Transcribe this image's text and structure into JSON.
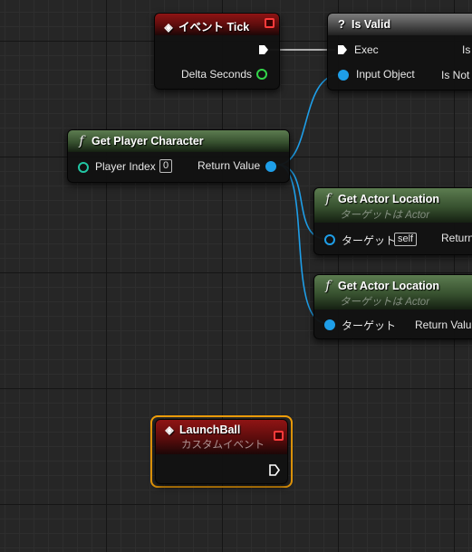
{
  "colors": {
    "event_header": "#8f1414",
    "pure_header": "#5c7c50",
    "macro_header": "#7c7c7c",
    "object_pin": "#1e9ee8",
    "float_pin": "#33d64a",
    "int_pin": "#22c6a4",
    "selection": "#f5a20a"
  },
  "nodes": {
    "event_tick": {
      "title": "イベント Tick",
      "icon": "event-diamond-icon",
      "out_pin": "Delta Seconds"
    },
    "is_valid": {
      "title": "Is Valid",
      "icon": "question-icon",
      "exec_in": "Exec",
      "out_is": "Is",
      "in_pin": "Input Object",
      "out_not": "Is Not"
    },
    "get_player_character": {
      "title": "Get Player Character",
      "icon": "function-icon",
      "in_pin": "Player Index",
      "in_value": "0",
      "out_pin": "Return Value"
    },
    "get_actor_location_1": {
      "title": "Get Actor Location",
      "subtitle": "ターゲットは Actor",
      "icon": "function-icon",
      "in_pin": "ターゲット",
      "in_value": "self",
      "out_pin": "Return"
    },
    "get_actor_location_2": {
      "title": "Get Actor Location",
      "subtitle": "ターゲットは Actor",
      "icon": "function-icon",
      "in_pin": "ターゲット",
      "out_pin": "Return Valu"
    },
    "launch_ball": {
      "title": "LaunchBall",
      "subtitle": "カスタムイベント",
      "icon": "event-diamond-icon",
      "selected": true
    }
  }
}
